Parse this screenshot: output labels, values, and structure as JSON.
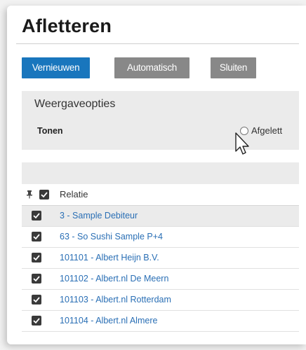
{
  "page": {
    "title": "Afletteren"
  },
  "toolbar": {
    "refresh_label": "Vernieuwen",
    "automatic_label": "Automatisch",
    "close_label": "Sluiten"
  },
  "options": {
    "heading": "Weergaveopties",
    "show_label": "Tonen",
    "radio_option": "Afgelett"
  },
  "grid": {
    "column_header": "Relatie",
    "rows": [
      {
        "label": "3 - Sample Debiteur",
        "checked": true
      },
      {
        "label": "63 - So Sushi Sample P+4",
        "checked": true
      },
      {
        "label": "101101 - Albert Heijn B.V.",
        "checked": true
      },
      {
        "label": "101102 - Albert.nl De Meern",
        "checked": true
      },
      {
        "label": "101103 - Albert.nl Rotterdam",
        "checked": true
      },
      {
        "label": "101104 - Albert.nl Almere",
        "checked": true
      }
    ]
  },
  "colors": {
    "primary": "#1976bd",
    "secondary_button": "#888888",
    "link": "#2a6fb5",
    "panel": "#ebebeb"
  }
}
